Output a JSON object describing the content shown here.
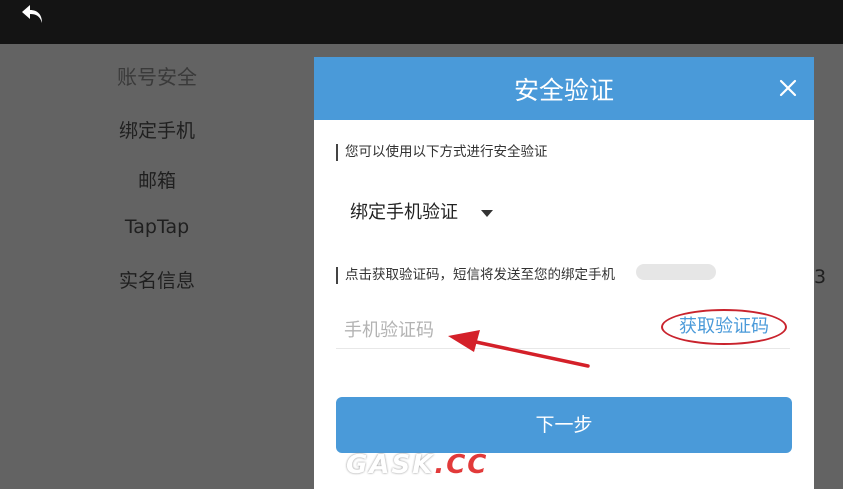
{
  "colors": {
    "accent": "#4a9ad9",
    "annotation": "#c9232d"
  },
  "topbar": {
    "back_icon": "back-arrow-icon"
  },
  "side_menu": {
    "header": "账号安全",
    "items": [
      "绑定手机",
      "邮箱",
      "TapTap",
      "实名信息"
    ]
  },
  "edge_text": "3",
  "dialog": {
    "title": "安全验证",
    "close_icon": "close-icon",
    "hint1": "您可以使用以下方式进行安全验证",
    "method": "绑定手机验证",
    "hint2": "点击获取验证码，短信将发送至您的绑定手机",
    "code_placeholder": "手机验证码",
    "get_code_label": "获取验证码",
    "next_label": "下一步"
  },
  "watermark": {
    "part1": "GASK",
    "part2": ".CC"
  }
}
